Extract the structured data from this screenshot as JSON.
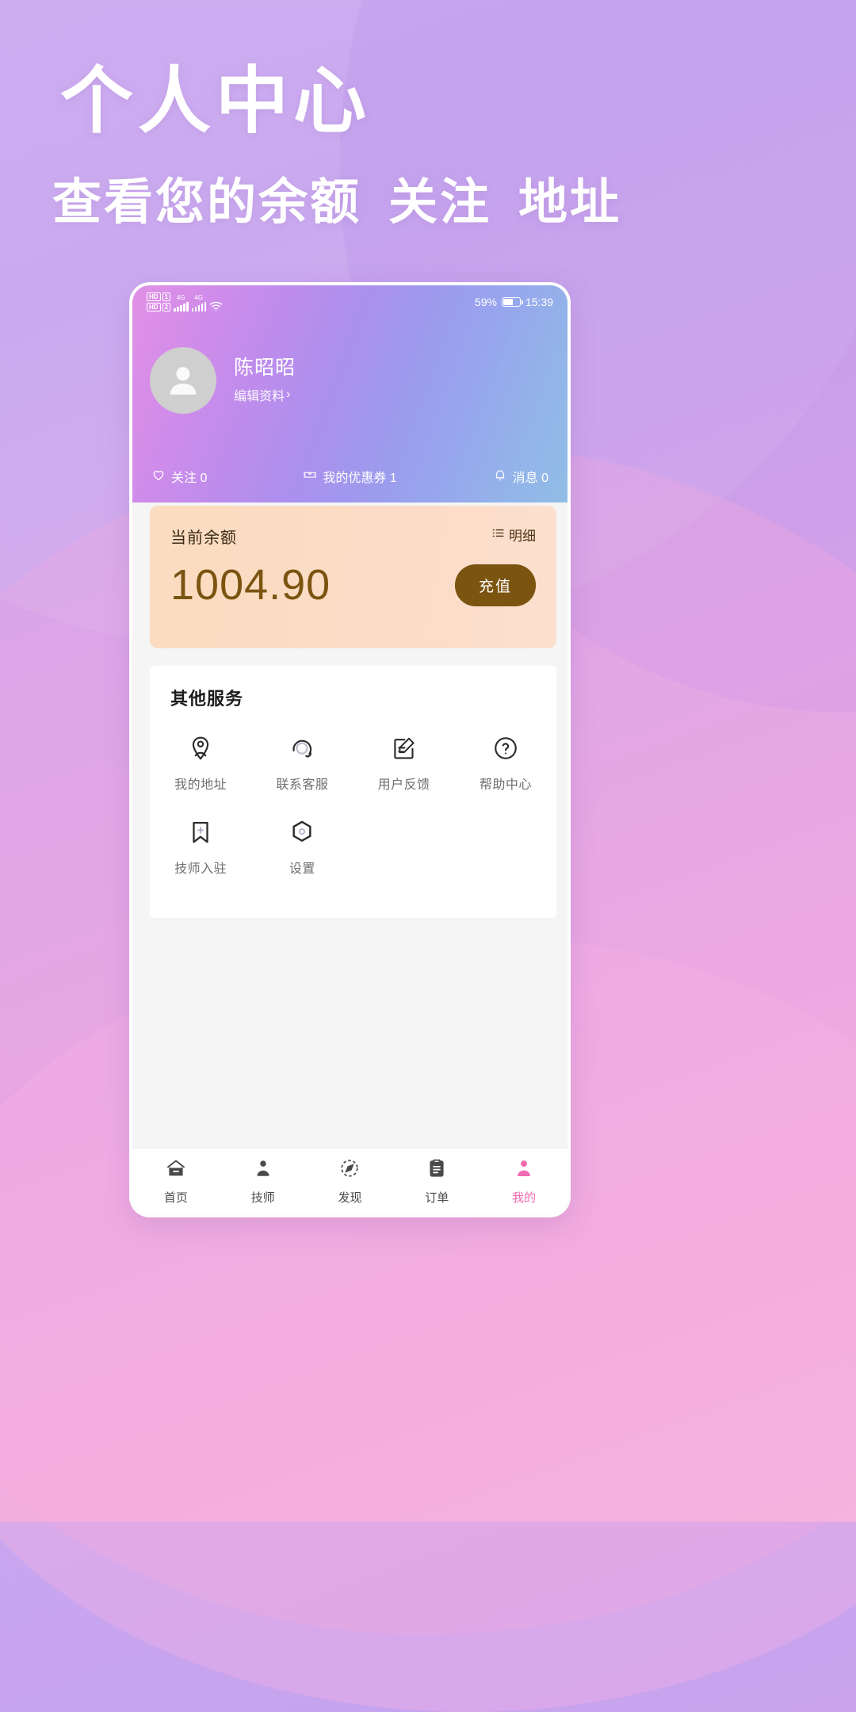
{
  "promo": {
    "title": "个人中心",
    "subtitle_parts": [
      "查看您的余额",
      "关注",
      "地址"
    ],
    "subtitle": "查看您的余额 关注 地址"
  },
  "status_bar": {
    "hd_badge_1": "HD",
    "hd_badge_2": "HD",
    "sim_1": "1",
    "sim_2": "2",
    "network_1": "4G",
    "network_2": "4G",
    "wifi_icon": "wifi-icon",
    "battery_percent": "59%",
    "battery_level": 59,
    "time": "15:39"
  },
  "profile": {
    "avatar_icon": "person-avatar-icon",
    "name": "陈昭昭",
    "edit_label": "编辑资料",
    "edit_chevron": "›"
  },
  "stats": [
    {
      "icon": "heart-icon",
      "label": "关注",
      "value": "0",
      "text": "关注 0"
    },
    {
      "icon": "ticket-icon",
      "label": "我的优惠券",
      "value": "1",
      "text": "我的优惠券 1"
    },
    {
      "icon": "bell-icon",
      "label": "消息",
      "value": "0",
      "text": "消息 0"
    }
  ],
  "balance": {
    "label": "当前余额",
    "detail_label": "明细",
    "detail_icon": "list-icon",
    "amount": "1004.90",
    "topup_label": "充值",
    "card_bg_start": "#fbdcc0",
    "card_bg_end": "#fde0cf",
    "amount_color": "#7a5410",
    "button_color": "#7b5410"
  },
  "services": {
    "title": "其他服务",
    "items": [
      {
        "icon": "location-pin-person-icon",
        "label": "我的地址"
      },
      {
        "icon": "headset-support-icon",
        "label": "联系客服"
      },
      {
        "icon": "edit-note-icon",
        "label": "用户反馈"
      },
      {
        "icon": "question-circle-icon",
        "label": "帮助中心"
      },
      {
        "icon": "bookmark-plus-icon",
        "label": "技师入驻"
      },
      {
        "icon": "hexagon-gear-icon",
        "label": "设置"
      }
    ]
  },
  "tabbar": {
    "active_color": "#f06ab0",
    "items": [
      {
        "icon": "home-icon",
        "label": "首页",
        "active": false
      },
      {
        "icon": "technician-icon",
        "label": "技师",
        "active": false
      },
      {
        "icon": "discover-icon",
        "label": "发现",
        "active": false
      },
      {
        "icon": "order-clipboard-icon",
        "label": "订单",
        "active": false
      },
      {
        "icon": "profile-person-icon",
        "label": "我的",
        "active": true
      }
    ]
  }
}
